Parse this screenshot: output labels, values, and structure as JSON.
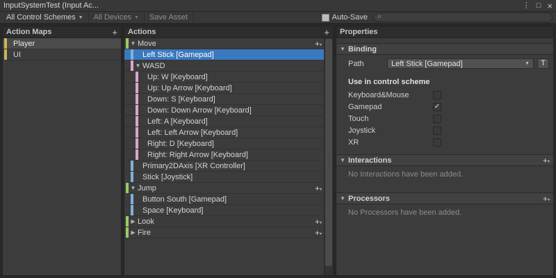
{
  "window": {
    "title": "InputSystemTest (Input Ac...",
    "menu_icon": "⋮",
    "maximize_icon": "□",
    "close_icon": "×"
  },
  "toolbar": {
    "control_schemes_label": "All Control Schemes",
    "devices_label": "All Devices",
    "save_asset_label": "Save Asset",
    "auto_save_label": "Auto-Save",
    "search_value": ""
  },
  "colors": {
    "map_bar": "#c9b758",
    "action_bar": "#9ac868",
    "binding_bar": "#7db2d8",
    "composite_bar": "#d9a6ce",
    "selection": "#3a79bf"
  },
  "action_maps": {
    "header": "Action Maps",
    "add_button": "+",
    "items": [
      {
        "label": "Player",
        "selected": true
      },
      {
        "label": "UI",
        "selected": false
      }
    ]
  },
  "actions": {
    "header": "Actions",
    "add_button": "+",
    "tree": [
      {
        "label": "Move",
        "depth": 0,
        "bar": "action_bar",
        "fold": "expanded",
        "add": true
      },
      {
        "label": "Left Stick [Gamepad]",
        "depth": 1,
        "bar": "binding_bar",
        "selected": true
      },
      {
        "label": "WASD",
        "depth": 1,
        "bar": "composite_bar",
        "fold": "expanded"
      },
      {
        "label": "Up: W [Keyboard]",
        "depth": 2,
        "bar": "composite_bar"
      },
      {
        "label": "Up: Up Arrow [Keyboard]",
        "depth": 2,
        "bar": "composite_bar"
      },
      {
        "label": "Down: S [Keyboard]",
        "depth": 2,
        "bar": "composite_bar"
      },
      {
        "label": "Down: Down Arrow [Keyboard]",
        "depth": 2,
        "bar": "composite_bar"
      },
      {
        "label": "Left: A [Keyboard]",
        "depth": 2,
        "bar": "composite_bar"
      },
      {
        "label": "Left: Left Arrow [Keyboard]",
        "depth": 2,
        "bar": "composite_bar"
      },
      {
        "label": "Right: D [Keyboard]",
        "depth": 2,
        "bar": "composite_bar"
      },
      {
        "label": "Right: Right Arrow [Keyboard]",
        "depth": 2,
        "bar": "composite_bar"
      },
      {
        "label": "Primary2DAxis [XR Controller]",
        "depth": 1,
        "bar": "binding_bar"
      },
      {
        "label": "Stick [Joystick]",
        "depth": 1,
        "bar": "binding_bar"
      },
      {
        "label": "Jump",
        "depth": 0,
        "bar": "action_bar",
        "fold": "expanded",
        "add": true
      },
      {
        "label": "Button South [Gamepad]",
        "depth": 1,
        "bar": "binding_bar"
      },
      {
        "label": "Space [Keyboard]",
        "depth": 1,
        "bar": "binding_bar"
      },
      {
        "label": "Look",
        "depth": 0,
        "bar": "action_bar",
        "fold": "collapsed",
        "add": true
      },
      {
        "label": "Fire",
        "depth": 0,
        "bar": "action_bar",
        "fold": "collapsed",
        "add": true
      }
    ]
  },
  "properties": {
    "header": "Properties",
    "binding": {
      "title": "Binding",
      "path_label": "Path",
      "path_value": "Left Stick [Gamepad]",
      "text_button": "T",
      "scheme_heading": "Use in control scheme",
      "schemes": [
        {
          "label": "Keyboard&Mouse",
          "checked": false
        },
        {
          "label": "Gamepad",
          "checked": true
        },
        {
          "label": "Touch",
          "checked": false
        },
        {
          "label": "Joystick",
          "checked": false
        },
        {
          "label": "XR",
          "checked": false
        }
      ]
    },
    "interactions": {
      "title": "Interactions",
      "add_button": "+",
      "empty_text": "No Interactions have been added."
    },
    "processors": {
      "title": "Processors",
      "add_button": "+",
      "empty_text": "No Processors have been added."
    }
  }
}
